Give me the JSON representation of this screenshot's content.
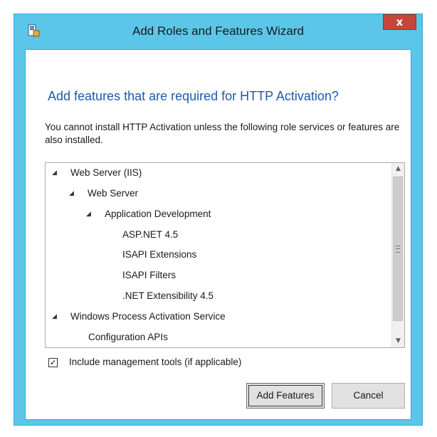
{
  "window": {
    "title": "Add Roles and Features Wizard",
    "close_label": "x",
    "app_icon": "server-manager-icon"
  },
  "dialog": {
    "heading": "Add features that are required for HTTP Activation?",
    "description": "You cannot install HTTP Activation unless the following role services or features are also installed."
  },
  "tree": {
    "items": [
      {
        "label": "Web Server (IIS)",
        "level": 0,
        "expandable": true
      },
      {
        "label": "Web Server",
        "level": 1,
        "expandable": true
      },
      {
        "label": "Application Development",
        "level": 2,
        "expandable": true
      },
      {
        "label": "ASP.NET 4.5",
        "level": 3,
        "expandable": false
      },
      {
        "label": "ISAPI Extensions",
        "level": 3,
        "expandable": false
      },
      {
        "label": "ISAPI Filters",
        "level": 3,
        "expandable": false
      },
      {
        "label": ".NET Extensibility 4.5",
        "level": 3,
        "expandable": false
      },
      {
        "label": "Windows Process Activation Service",
        "level": 0,
        "expandable": true
      },
      {
        "label": "Configuration APIs",
        "level": 1,
        "expandable": false
      }
    ]
  },
  "options": {
    "include_tools_label": "Include management tools (if applicable)",
    "include_tools_checked": true
  },
  "buttons": {
    "add_features": "Add Features",
    "cancel": "Cancel"
  },
  "colors": {
    "frame": "#5bc6e8",
    "heading": "#1e5aa8",
    "close": "#c7463a"
  }
}
